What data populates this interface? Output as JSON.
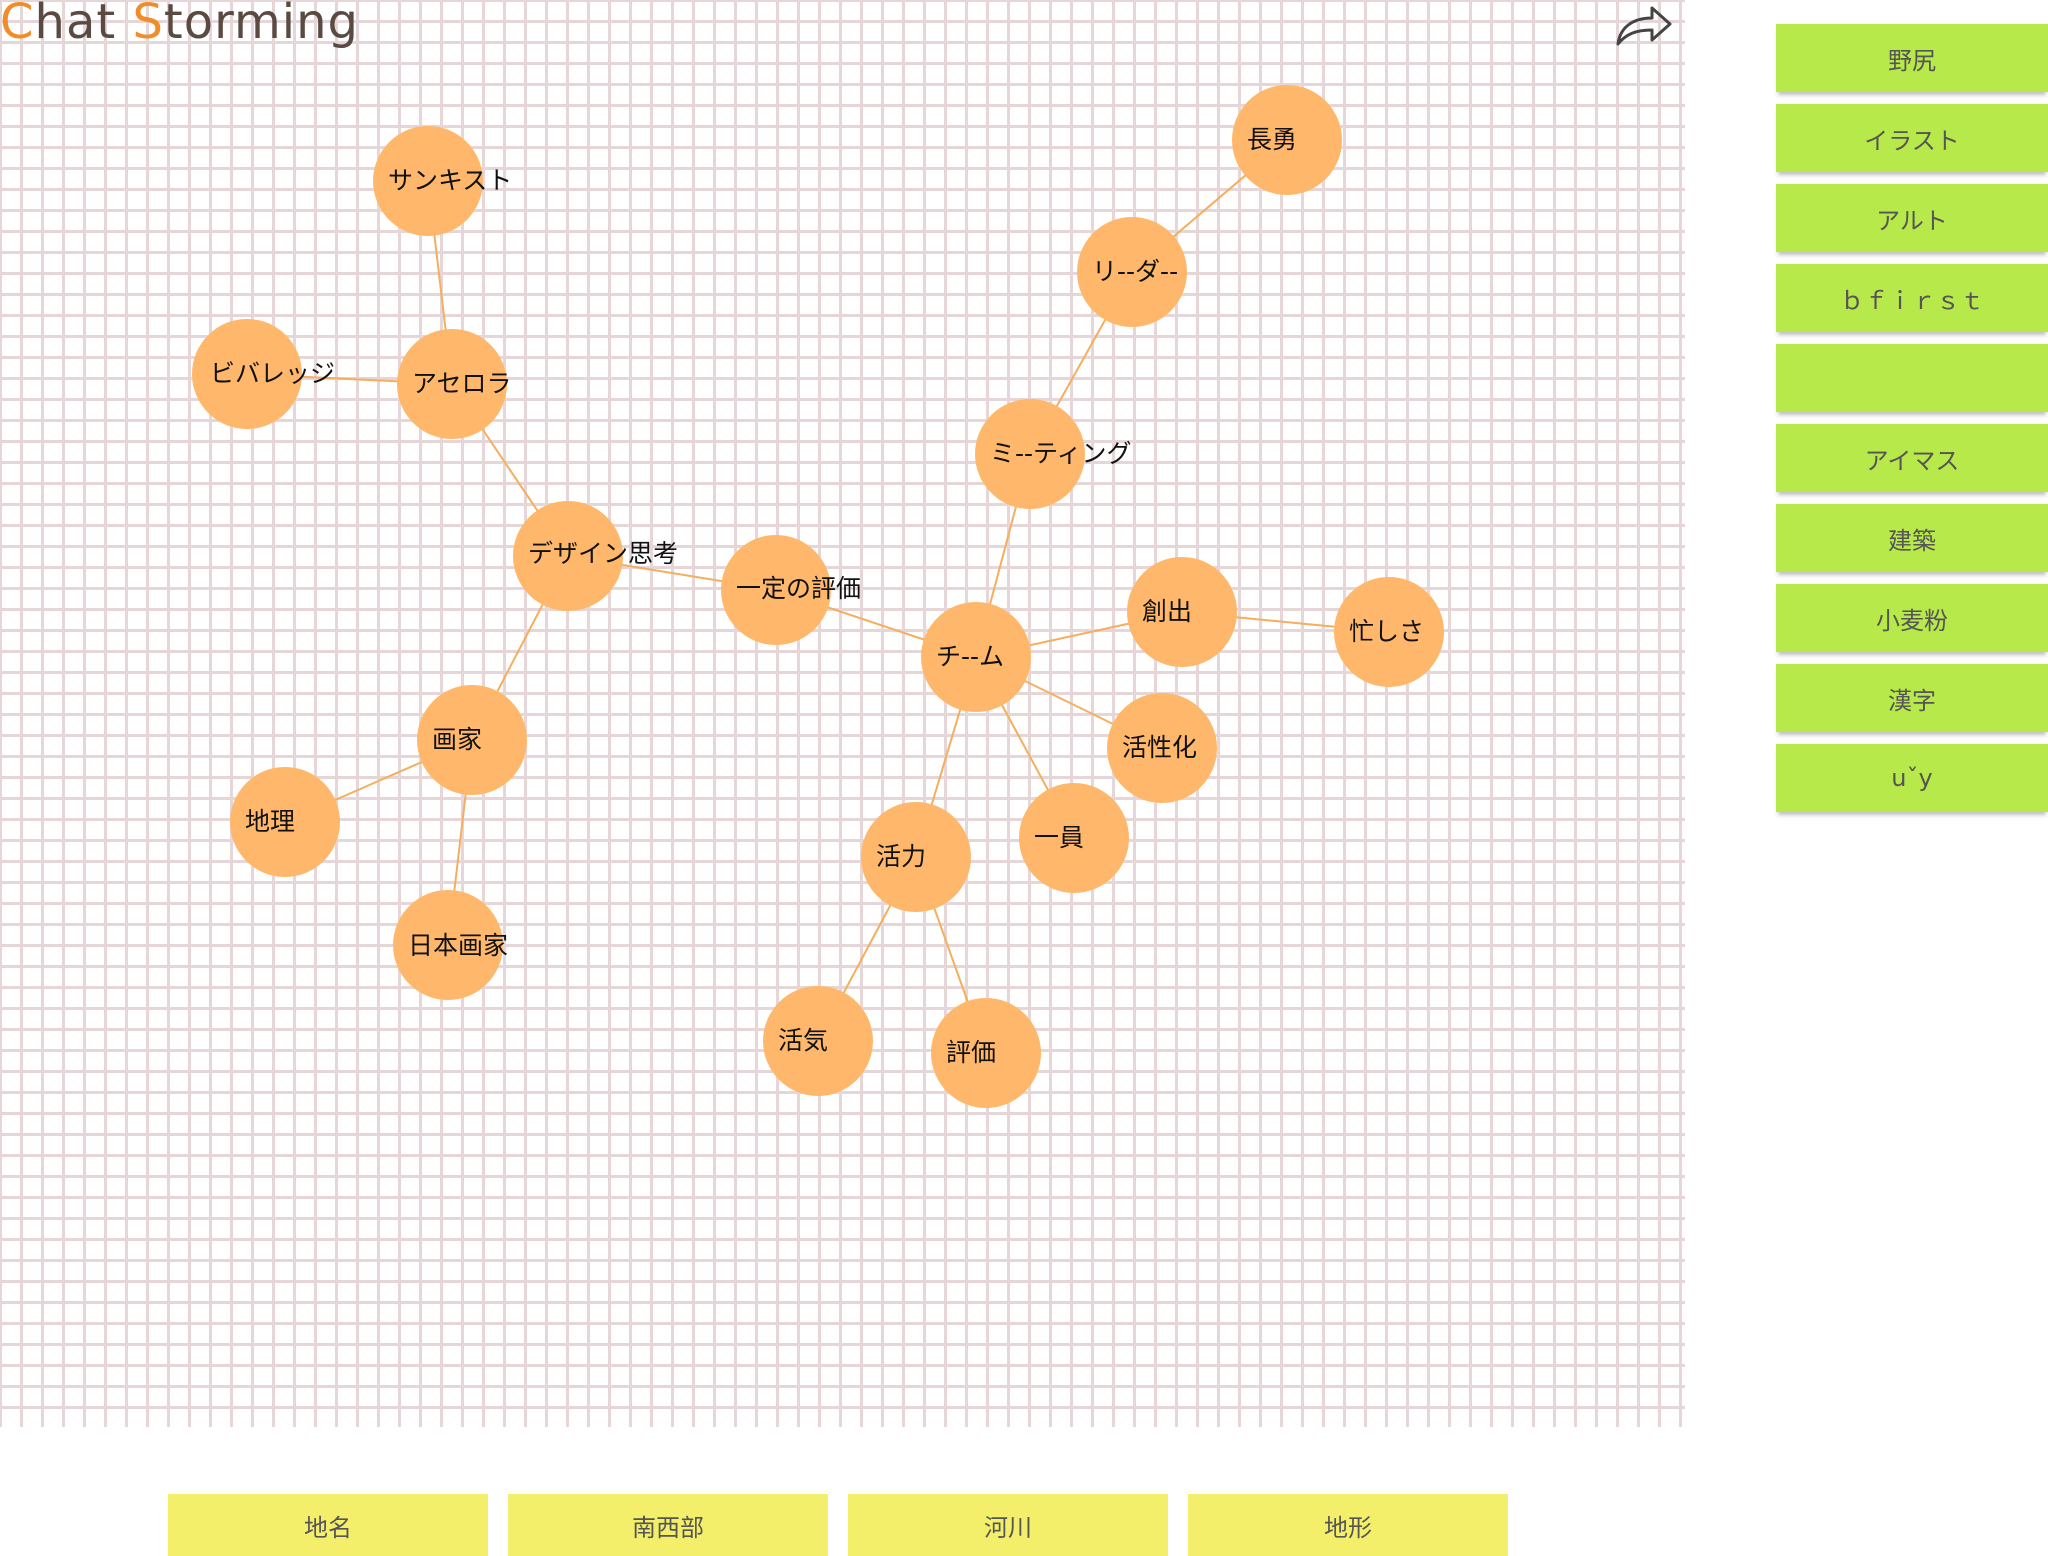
{
  "app": {
    "logo_c": "C",
    "logo_hat": "hat",
    "logo_s": "S",
    "logo_torming": "torming"
  },
  "colors": {
    "node_fill": "#ffb86b",
    "edge": "#f5ae5e",
    "suggestion_card": "#b7e94a",
    "category_card": "#f4ef6a",
    "logo_accent": "#f28c28",
    "logo_text": "#5a4a42",
    "grid_line": "#e6d6d8"
  },
  "icons": {
    "share": "share-arrow-icon"
  },
  "mindmap": {
    "nodes": [
      {
        "id": "n_sunkist",
        "label": "サンキスト"
      },
      {
        "id": "n_acerola",
        "label": "アセロラ"
      },
      {
        "id": "n_beverage",
        "label": "ビバレッジ"
      },
      {
        "id": "n_design",
        "label": "デザイン思考"
      },
      {
        "id": "n_ittei",
        "label": "一定の評価"
      },
      {
        "id": "n_gaka",
        "label": "画家"
      },
      {
        "id": "n_chiri",
        "label": "地理"
      },
      {
        "id": "n_nihongaka",
        "label": "日本画家"
      },
      {
        "id": "n_chousei",
        "label": "長勇"
      },
      {
        "id": "n_leader",
        "label": "リ--ダ--"
      },
      {
        "id": "n_meeting",
        "label": "ミ--ティング"
      },
      {
        "id": "n_team",
        "label": "チ--ム"
      },
      {
        "id": "n_soushutsu",
        "label": "創出"
      },
      {
        "id": "n_isogashisa",
        "label": "忙しさ"
      },
      {
        "id": "n_kasseika",
        "label": "活性化"
      },
      {
        "id": "n_ichiin",
        "label": "一員"
      },
      {
        "id": "n_katsuryoku",
        "label": "活力"
      },
      {
        "id": "n_kakki",
        "label": "活気"
      },
      {
        "id": "n_hyouka",
        "label": "評価"
      }
    ],
    "edges": [
      [
        "n_sunkist",
        "n_acerola"
      ],
      [
        "n_beverage",
        "n_acerola"
      ],
      [
        "n_acerola",
        "n_design"
      ],
      [
        "n_design",
        "n_ittei"
      ],
      [
        "n_design",
        "n_gaka"
      ],
      [
        "n_gaka",
        "n_chiri"
      ],
      [
        "n_gaka",
        "n_nihongaka"
      ],
      [
        "n_ittei",
        "n_team"
      ],
      [
        "n_chousei",
        "n_leader"
      ],
      [
        "n_leader",
        "n_meeting"
      ],
      [
        "n_meeting",
        "n_team"
      ],
      [
        "n_team",
        "n_soushutsu"
      ],
      [
        "n_soushutsu",
        "n_isogashisa"
      ],
      [
        "n_team",
        "n_kasseika"
      ],
      [
        "n_team",
        "n_ichiin"
      ],
      [
        "n_team",
        "n_katsuryoku"
      ],
      [
        "n_katsuryoku",
        "n_kakki"
      ],
      [
        "n_katsuryoku",
        "n_hyouka"
      ]
    ]
  },
  "suggestions": [
    "野尻",
    "イラスト",
    "アルト",
    "ｂｆｉｒｓｔ",
    "",
    "アイマス",
    "建築",
    "小麦粉",
    "漢字",
    "uˇy"
  ],
  "categories": [
    "地名",
    "南西部",
    "河川",
    "地形"
  ]
}
